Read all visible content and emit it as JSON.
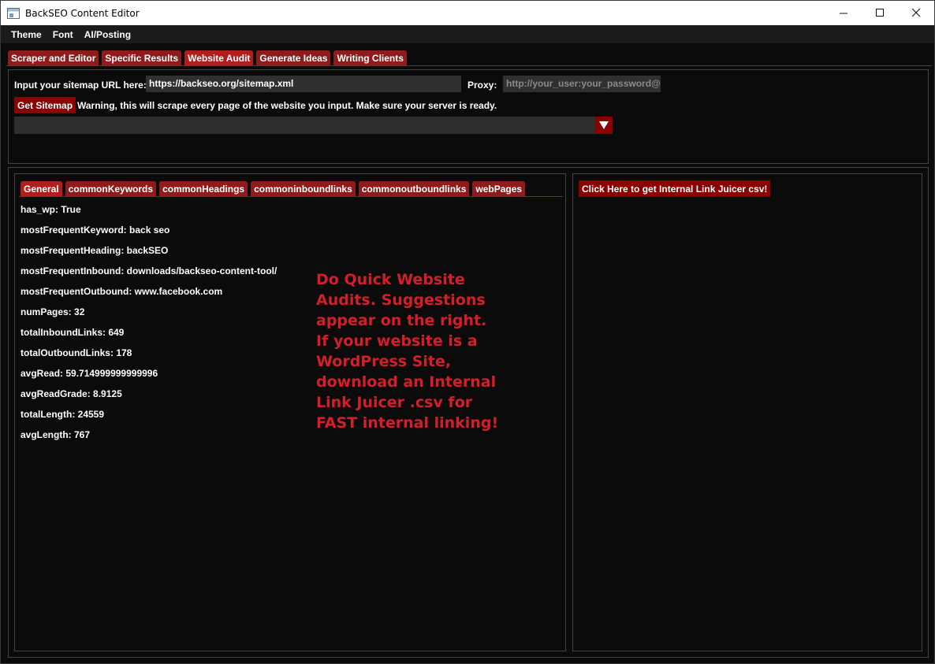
{
  "window": {
    "title": "BackSEO Content Editor",
    "controls": [
      "minimize",
      "maximize",
      "close"
    ]
  },
  "menu": [
    "Theme",
    "Font",
    "AI/Posting"
  ],
  "main_tabs": [
    {
      "label": "Scraper and Editor",
      "active": false
    },
    {
      "label": "Specific Results",
      "active": false
    },
    {
      "label": "Website Audit",
      "active": true
    },
    {
      "label": "Generate Ideas",
      "active": false
    },
    {
      "label": "Writing Clients",
      "active": false
    }
  ],
  "sitemap": {
    "label": "Input your sitemap URL here:",
    "value": "https://backseo.org/sitemap.xml",
    "proxy_label": "Proxy:",
    "proxy_placeholder": "http://your_user:your_password@you",
    "button_label": "Get Sitemap",
    "warning": "Warning, this will scrape every page of the website you input. Make sure your server is ready.",
    "dropdown_value": ""
  },
  "audit_tabs": [
    {
      "label": "General",
      "active": true
    },
    {
      "label": "commonKeywords",
      "active": false
    },
    {
      "label": "commonHeadings",
      "active": false
    },
    {
      "label": "commoninboundlinks",
      "active": false
    },
    {
      "label": "commonoutboundlinks",
      "active": false
    },
    {
      "label": "webPages",
      "active": false
    }
  ],
  "general_stats": [
    "has_wp: True",
    "mostFrequentKeyword: back seo",
    "mostFrequentHeading: backSEO",
    "mostFrequentInbound: downloads/backseo-content-tool/",
    "mostFrequentOutbound: www.facebook.com",
    "numPages: 32",
    "totalInboundLinks: 649",
    "totalOutboundLinks: 178",
    "avgRead: 59.714999999999996",
    "avgReadGrade: 8.9125",
    "totalLength: 24559",
    "avgLength: 767"
  ],
  "promo_text": "Do Quick Website\nAudits. Suggestions\nappear on the right.\nIf your website is a\nWordPress Site,\ndownload an Internal\nLink Juicer .csv for\nFAST internal linking!",
  "right_panel": {
    "button_label": "Click Here to get Internal Link Juicer csv!"
  },
  "colors": {
    "accent": "#8b0000",
    "tab": "#8e1c1c",
    "tab_active": "#b11e1e",
    "promo": "#d41e2a",
    "background": "#0b0b0b"
  }
}
